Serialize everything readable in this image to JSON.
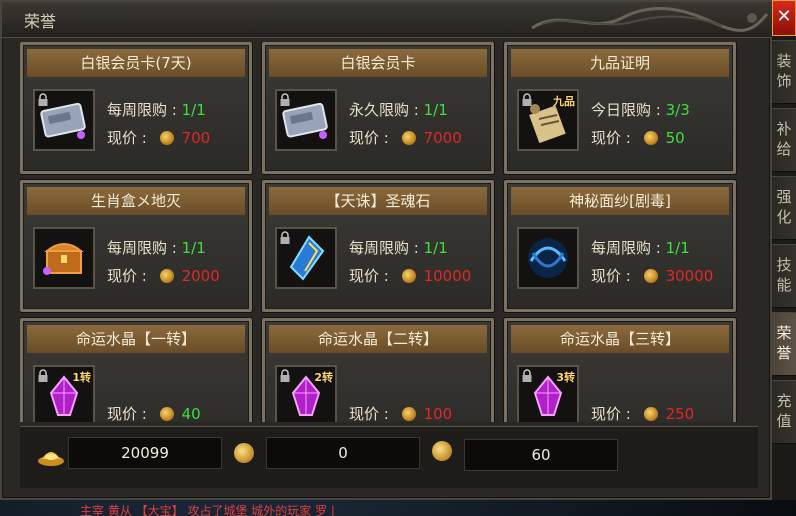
{
  "window": {
    "title": "荣誉",
    "close_label": "✕"
  },
  "items": [
    {
      "name": "白银会员卡(7天)",
      "limit_label": "每周限购 : ",
      "limit_value": "1/1",
      "price_label": "现价 : ",
      "price": "700",
      "price_color": "red",
      "icon": "silver-card-icon",
      "locked": true,
      "badge": ""
    },
    {
      "name": "白银会员卡",
      "limit_label": "永久限购 : ",
      "limit_value": "1/1",
      "price_label": "现价 : ",
      "price": "7000",
      "price_color": "red",
      "icon": "silver-card-icon",
      "locked": true,
      "badge": ""
    },
    {
      "name": "九品证明",
      "limit_label": "今日限购 : ",
      "limit_value": "3/3",
      "price_label": "现价 : ",
      "price": "50",
      "price_color": "green",
      "icon": "scroll-icon",
      "locked": true,
      "badge": "九品"
    },
    {
      "name": "生肖盒メ地灭",
      "limit_label": "每周限购 : ",
      "limit_value": "1/1",
      "price_label": "现价 : ",
      "price": "2000",
      "price_color": "red",
      "icon": "treasure-chest-icon",
      "locked": false,
      "badge": ""
    },
    {
      "name": "【天诛】圣魂石",
      "limit_label": "每周限购 : ",
      "limit_value": "1/1",
      "price_label": "现价 : ",
      "price": "10000",
      "price_color": "red",
      "icon": "soul-stone-icon",
      "locked": true,
      "badge": ""
    },
    {
      "name": "神秘面纱[剧毒]",
      "limit_label": "每周限购 : ",
      "limit_value": "1/1",
      "price_label": "现价 : ",
      "price": "30000",
      "price_color": "red",
      "icon": "mystic-veil-icon",
      "locked": false,
      "badge": ""
    },
    {
      "name": "命运水晶【一转】",
      "limit_label": "",
      "limit_value": "",
      "price_label": "现价 : ",
      "price": "40",
      "price_color": "green",
      "icon": "fate-crystal-icon",
      "locked": true,
      "badge": "1转"
    },
    {
      "name": "命运水晶【二转】",
      "limit_label": "",
      "limit_value": "",
      "price_label": "现价 : ",
      "price": "100",
      "price_color": "red",
      "icon": "fate-crystal-icon",
      "locked": true,
      "badge": "2转"
    },
    {
      "name": "命运水晶【三转】",
      "limit_label": "",
      "limit_value": "",
      "price_label": "现价 : ",
      "price": "250",
      "price_color": "red",
      "icon": "fate-crystal-icon",
      "locked": true,
      "badge": "3转"
    }
  ],
  "currency": {
    "ingot_value": "20099",
    "coin_value": "0",
    "honor_value": "60"
  },
  "side_tabs": [
    {
      "label": "装饰",
      "active": false
    },
    {
      "label": "补给",
      "active": false
    },
    {
      "label": "强化",
      "active": false
    },
    {
      "label": "技能",
      "active": false
    },
    {
      "label": "荣誉",
      "active": true
    },
    {
      "label": "充值",
      "active": false
    }
  ],
  "background_chat": "主宰 黄从 【大宝】 攻占了城堡 城外的玩家 罗 | "
}
